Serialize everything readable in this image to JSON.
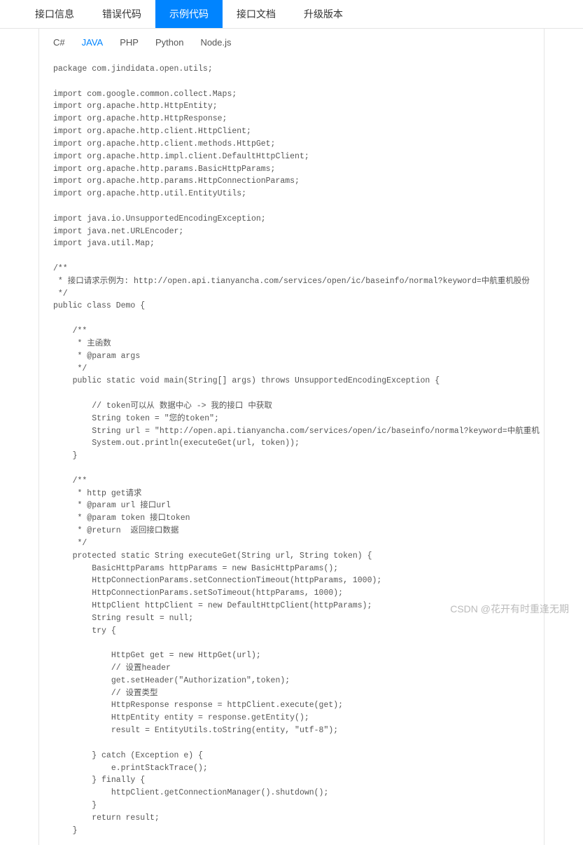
{
  "topTabs": {
    "items": [
      {
        "label": "接口信息",
        "active": false
      },
      {
        "label": "错误代码",
        "active": false
      },
      {
        "label": "示例代码",
        "active": true
      },
      {
        "label": "接口文档",
        "active": false
      },
      {
        "label": "升级版本",
        "active": false
      }
    ]
  },
  "langTabs": {
    "items": [
      {
        "label": "C#",
        "active": false
      },
      {
        "label": "JAVA",
        "active": true
      },
      {
        "label": "PHP",
        "active": false
      },
      {
        "label": "Python",
        "active": false
      },
      {
        "label": "Node.js",
        "active": false
      }
    ]
  },
  "code": "package com.jindidata.open.utils;\n\nimport com.google.common.collect.Maps;\nimport org.apache.http.HttpEntity;\nimport org.apache.http.HttpResponse;\nimport org.apache.http.client.HttpClient;\nimport org.apache.http.client.methods.HttpGet;\nimport org.apache.http.impl.client.DefaultHttpClient;\nimport org.apache.http.params.BasicHttpParams;\nimport org.apache.http.params.HttpConnectionParams;\nimport org.apache.http.util.EntityUtils;\n\nimport java.io.UnsupportedEncodingException;\nimport java.net.URLEncoder;\nimport java.util.Map;\n\n/**\n * 接口请求示例为: http://open.api.tianyancha.com/services/open/ic/baseinfo/normal?keyword=中航重机股份\n */\npublic class Demo {\n\n    /**\n     * 主函数\n     * @param args\n     */\n    public static void main(String[] args) throws UnsupportedEncodingException {\n\n        // token可以从 数据中心 -> 我的接口 中获取\n        String token = \"您的token\";\n        String url = \"http://open.api.tianyancha.com/services/open/ic/baseinfo/normal?keyword=中航重机\n        System.out.println(executeGet(url, token));\n    }\n\n    /**\n     * http get请求\n     * @param url 接口url\n     * @param token 接口token\n     * @return  返回接口数据\n     */\n    protected static String executeGet(String url, String token) {\n        BasicHttpParams httpParams = new BasicHttpParams();\n        HttpConnectionParams.setConnectionTimeout(httpParams, 1000);\n        HttpConnectionParams.setSoTimeout(httpParams, 1000);\n        HttpClient httpClient = new DefaultHttpClient(httpParams);\n        String result = null;\n        try {\n\n            HttpGet get = new HttpGet(url);\n            // 设置header\n            get.setHeader(\"Authorization\",token);\n            // 设置类型\n            HttpResponse response = httpClient.execute(get);\n            HttpEntity entity = response.getEntity();\n            result = EntityUtils.toString(entity, \"utf-8\");\n\n        } catch (Exception e) {\n            e.printStackTrace();\n        } finally {\n            httpClient.getConnectionManager().shutdown();\n        }\n        return result;\n    }",
  "watermark": "CSDN @花开有时重逢无期"
}
